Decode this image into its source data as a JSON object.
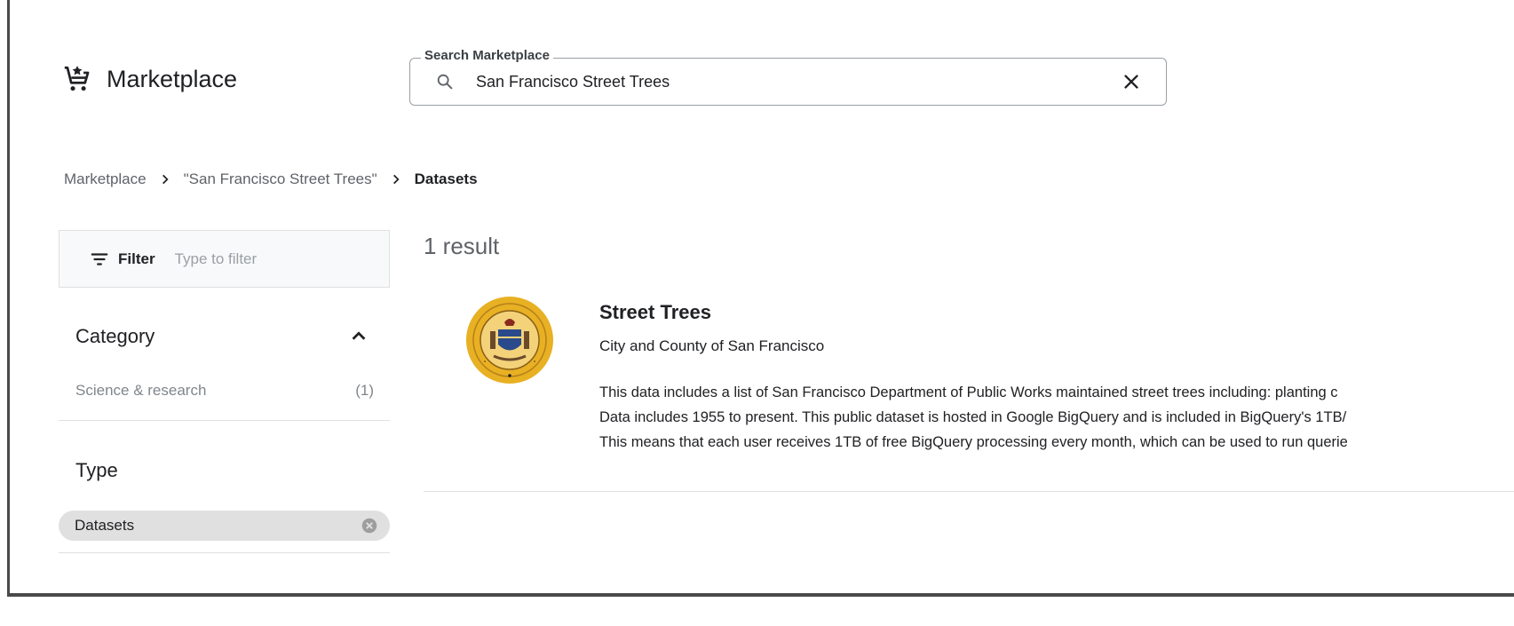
{
  "header": {
    "title": "Marketplace",
    "search": {
      "label": "Search Marketplace",
      "value": "San Francisco Street Trees"
    }
  },
  "breadcrumb": {
    "items": [
      "Marketplace",
      "\"San Francisco Street Trees\"",
      "Datasets"
    ]
  },
  "filter": {
    "label": "Filter",
    "placeholder": "Type to filter"
  },
  "category": {
    "title": "Category",
    "items": [
      {
        "label": "Science & research",
        "count": "(1)"
      }
    ]
  },
  "type": {
    "title": "Type",
    "chip": "Datasets"
  },
  "results": {
    "count": "1 result",
    "items": [
      {
        "title": "Street Trees",
        "publisher": "City and County of San Francisco",
        "description": [
          "This data includes a list of San Francisco Department of Public Works maintained street trees including: planting c",
          "Data includes 1955 to present. This public dataset is hosted in Google BigQuery and is included in BigQuery's 1TB/",
          "This means that each user receives 1TB of free BigQuery processing every month, which can be used to run querie"
        ]
      }
    ]
  },
  "icons": {
    "brand": "marketplace-cart-icon",
    "search": "search-icon",
    "clear": "close-icon",
    "filter": "filter-icon",
    "collapse": "chevron-up-icon",
    "chip_remove": "cancel-icon",
    "seal": "san-francisco-seal"
  },
  "colors": {
    "seal_gold": "#e8b023",
    "seal_blue": "#2b4a8b",
    "chip_bg": "#e0e0e0",
    "frame": "#4a4a4a"
  }
}
